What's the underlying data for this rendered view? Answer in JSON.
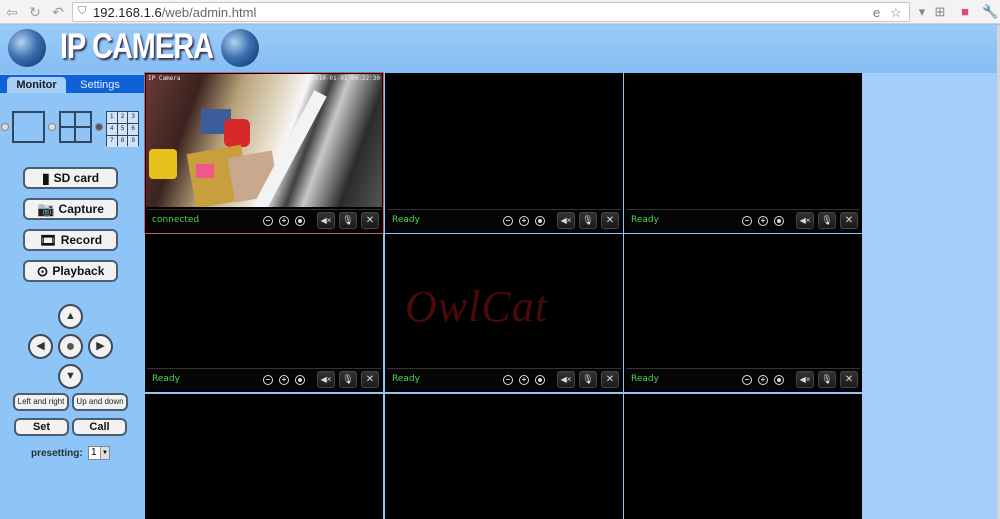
{
  "browser": {
    "url_host": "192.168.1.6",
    "url_path": "/web/admin.html",
    "icons": [
      "back-icon",
      "reload-icon",
      "undo-icon",
      "shield-icon",
      "ie-compat-icon",
      "star-icon",
      "dropdown-icon",
      "tabs-icon",
      "extension-icon",
      "wrench-icon"
    ]
  },
  "header": {
    "title": "IP CAMERA"
  },
  "sidebar": {
    "tabs": [
      {
        "label": "Monitor",
        "active": true
      },
      {
        "label": "Settings",
        "active": false
      }
    ],
    "layouts": [
      {
        "name": "1-view",
        "checked": false
      },
      {
        "name": "4-view",
        "checked": false
      },
      {
        "name": "9-view",
        "checked": true,
        "numbers": [
          "1",
          "2",
          "3",
          "4",
          "5",
          "6",
          "7",
          "8",
          "9"
        ]
      }
    ],
    "actions": [
      {
        "label": "SD card",
        "icon": "sd-card-icon"
      },
      {
        "label": "Capture",
        "icon": "camera-icon"
      },
      {
        "label": "Record",
        "icon": "film-icon"
      },
      {
        "label": "Playback",
        "icon": "play-icon"
      }
    ],
    "ptz": {
      "up": "▲",
      "down": "▼",
      "left": "◀",
      "right": "▶",
      "center": "●"
    },
    "cruise": {
      "left_right": "Left and right",
      "up_down": "Up and down"
    },
    "preset": {
      "set": "Set",
      "call": "Call",
      "label": "presetting:",
      "value": "1"
    }
  },
  "cells": [
    {
      "status": "connected",
      "selected": true,
      "osd_name": "IP Camera",
      "osd_time": "2010-01-01 00:22:30"
    },
    {
      "status": "Ready"
    },
    {
      "status": "Ready"
    },
    {
      "status": "Ready"
    },
    {
      "status": "Ready"
    },
    {
      "status": "Ready"
    },
    {
      "status": ""
    },
    {
      "status": ""
    },
    {
      "status": ""
    }
  ],
  "cell_controls": {
    "zoom_out": "−",
    "zoom_in": "+",
    "mute": "◀×",
    "mic": "🎙",
    "settings": "✕"
  },
  "watermark": "OwlCat",
  "colors": {
    "status_green": "#4fd24f",
    "header_blue": "#8fc4f7",
    "tab_blue": "#0f62d6",
    "selected_border": "#d25a80"
  }
}
